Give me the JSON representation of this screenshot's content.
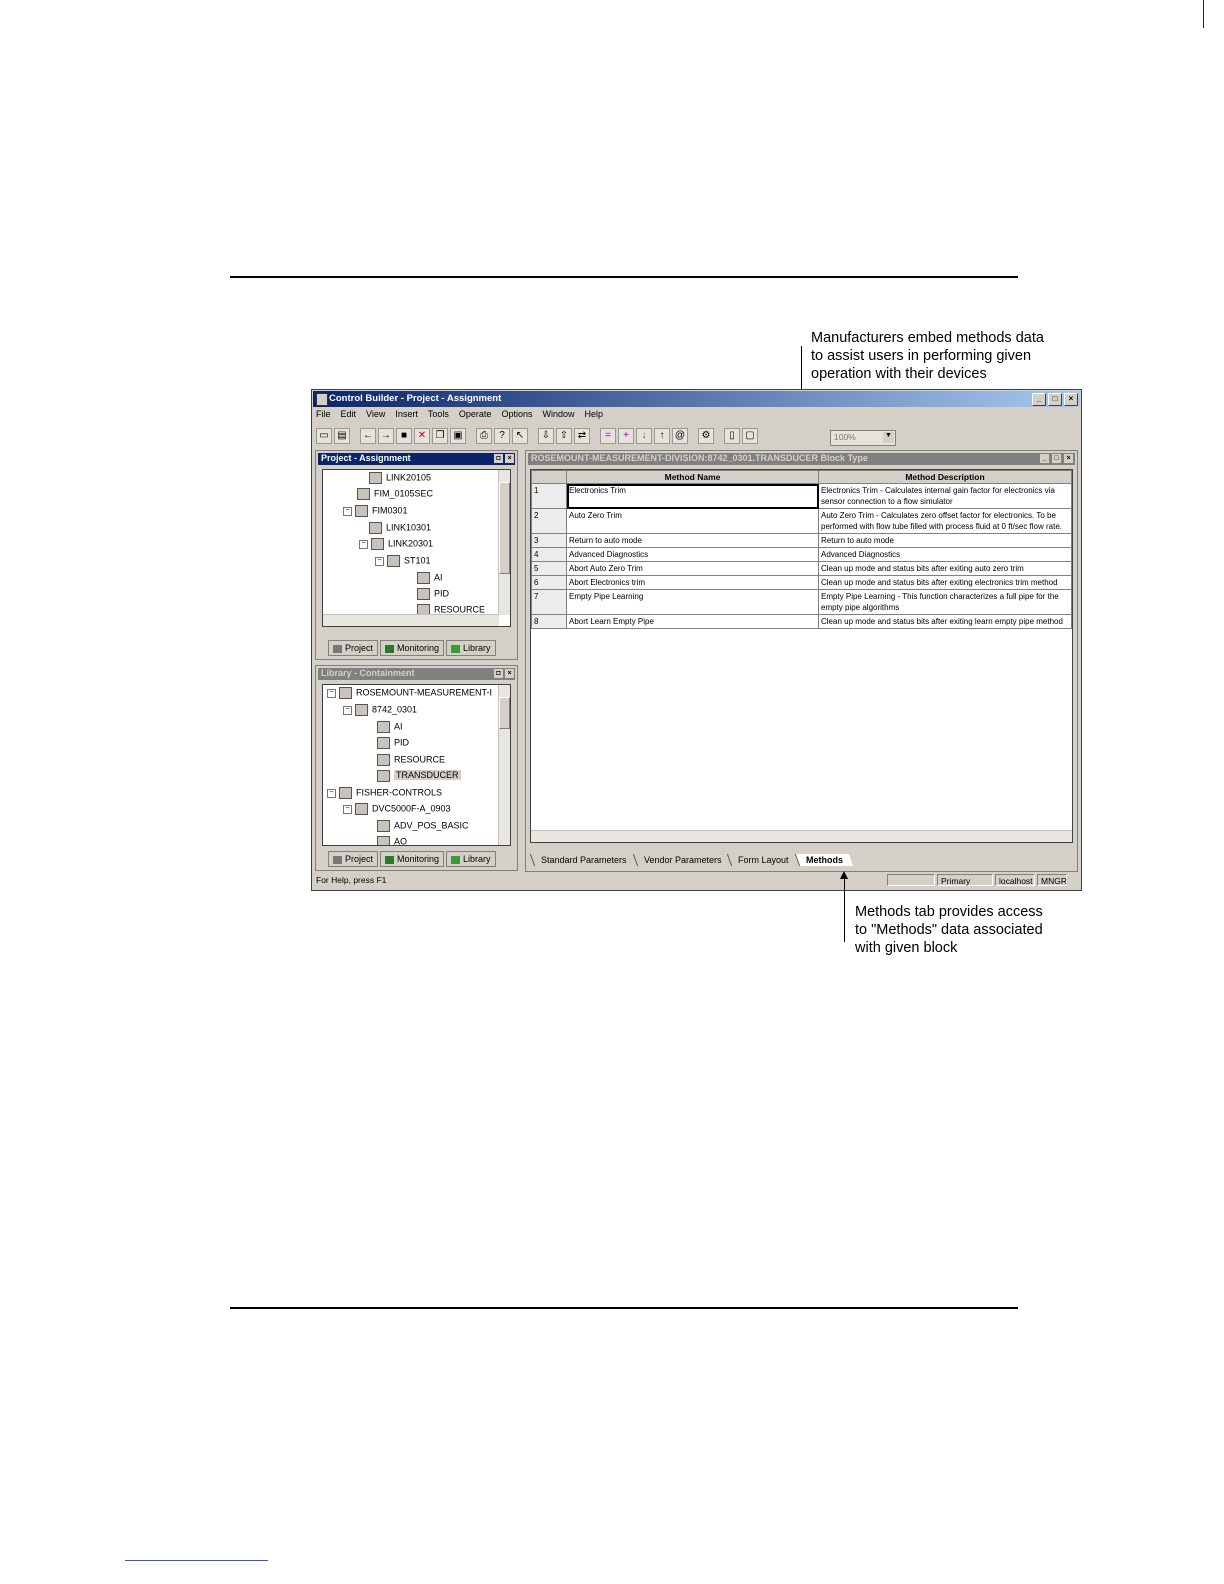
{
  "callouts": {
    "top": [
      "Manufacturers embed methods data",
      "to assist users in performing given",
      "operation with their devices"
    ],
    "bottom": [
      "Methods tab provides access",
      "to \"Methods\" data associated",
      "with given block"
    ]
  },
  "app": {
    "title": "Control Builder - Project - Assignment",
    "menu": [
      "File",
      "Edit",
      "View",
      "Insert",
      "Tools",
      "Operate",
      "Options",
      "Window",
      "Help"
    ],
    "zoom": "100%",
    "project_pane": {
      "title": "Project - Assignment",
      "tree": [
        "LINK20105",
        "FIM_0105SEC",
        "FIM0301",
        "LINK10301",
        "LINK20301",
        "ST101",
        "AI",
        "PID",
        "RESOURCE"
      ],
      "tabs": [
        "Project",
        "Monitoring",
        "Library"
      ]
    },
    "library_pane": {
      "title": "Library - Containment",
      "tree": [
        "ROSEMOUNT-MEASUREMENT-I",
        "8742_0301",
        "AI",
        "PID",
        "RESOURCE",
        "TRANSDUCER",
        "FISHER-CONTROLS",
        "DVC5000F-A_0903",
        "ADV_POS_BASIC",
        "AO"
      ],
      "tabs": [
        "Project",
        "Monitoring",
        "Library"
      ]
    },
    "block_window": {
      "title": "ROSEMOUNT-MEASUREMENT-DIVISION:8742_0301.TRANSDUCER Block Type",
      "columns": [
        "Method Name",
        "Method Description"
      ],
      "rows": [
        {
          "n": "1",
          "name": "Electronics Trim",
          "desc": "Electronics Trim - Calculates internal gain factor for electronics via sensor connection to a flow simulator"
        },
        {
          "n": "2",
          "name": "Auto Zero Trim",
          "desc": "Auto Zero Trim - Calculates zero offset factor for electronics. To be performed with flow tube filled with process fluid at 0 ft/sec flow rate."
        },
        {
          "n": "3",
          "name": "Return to auto mode",
          "desc": "Return to auto mode"
        },
        {
          "n": "4",
          "name": "Advanced Diagnostics",
          "desc": "Advanced Diagnostics"
        },
        {
          "n": "5",
          "name": "Abort Auto Zero Trim",
          "desc": "Clean up mode and status bits after exiting auto zero trim"
        },
        {
          "n": "6",
          "name": "Abort Electronics trim",
          "desc": "Clean up mode and status bits after exiting electronics trim method"
        },
        {
          "n": "7",
          "name": "Empty Pipe Learning",
          "desc": "Empty Pipe Learning - This function characterizes a full pipe for the empty pipe algorithms"
        },
        {
          "n": "8",
          "name": "Abort Learn Empty Pipe",
          "desc": "Clean up mode and status bits after exiting learn empty pipe method"
        }
      ],
      "tabs": [
        "Standard Parameters",
        "Vendor Parameters",
        "Form Layout",
        "Methods"
      ]
    },
    "status": {
      "help": "For Help, press F1",
      "primary": "Primary",
      "host": "localhost",
      "user": "MNGR"
    }
  }
}
